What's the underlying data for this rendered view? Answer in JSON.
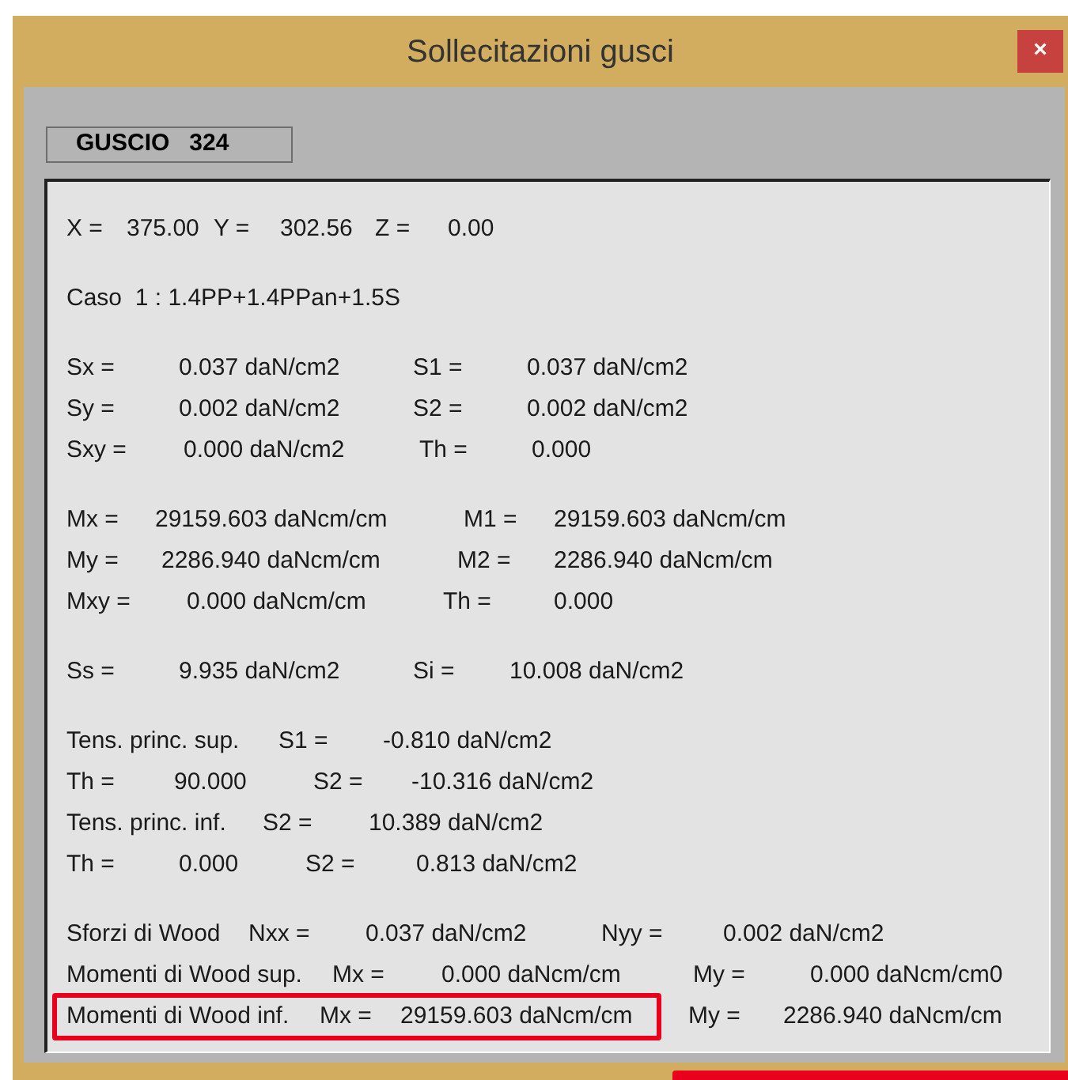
{
  "window": {
    "title": "Sollecitazioni gusci",
    "close": "×"
  },
  "shell_label": "GUSCIO   324",
  "blocks": [
    {
      "lines": [
        {
          "cells": [
            {
              "text": "X =",
              "highlighted": false
            },
            {
              "text": "375.00",
              "highlighted": false
            },
            {
              "text": "Y =",
              "highlighted": false
            },
            {
              "text": "302.56",
              "highlighted": false
            },
            {
              "text": "Z =",
              "highlighted": false
            },
            {
              "text": "0.00",
              "highlighted": false
            }
          ]
        }
      ]
    },
    {
      "lines": [
        {
          "cells": [
            {
              "text": "Caso  1 : 1.4PP+1.4PPan+1.5S",
              "highlighted": false
            }
          ]
        }
      ]
    },
    {
      "lines": [
        {
          "cells": [
            {
              "text": "Sx =",
              "highlighted": false
            },
            {
              "text": "0.037 daN/cm2",
              "highlighted": false
            },
            {
              "text": "S1 =",
              "highlighted": false
            },
            {
              "text": "0.037 daN/cm2",
              "highlighted": false
            }
          ]
        },
        {
          "cells": [
            {
              "text": "Sy =",
              "highlighted": false
            },
            {
              "text": "0.002 daN/cm2",
              "highlighted": false
            },
            {
              "text": "S2 =",
              "highlighted": false
            },
            {
              "text": "0.002 daN/cm2",
              "highlighted": false
            }
          ]
        },
        {
          "cells": [
            {
              "text": "Sxy =",
              "highlighted": false
            },
            {
              "text": "0.000 daN/cm2",
              "highlighted": false
            },
            {
              "text": "Th =",
              "highlighted": false
            },
            {
              "text": "0.000",
              "highlighted": false
            }
          ]
        }
      ]
    },
    {
      "lines": [
        {
          "cells": [
            {
              "text": "Mx =",
              "highlighted": false
            },
            {
              "text": "29159.603 daNcm/cm",
              "highlighted": false
            },
            {
              "text": "M1 =",
              "highlighted": false
            },
            {
              "text": "29159.603 daNcm/cm",
              "highlighted": false
            }
          ]
        },
        {
          "cells": [
            {
              "text": "My =",
              "highlighted": false
            },
            {
              "text": "2286.940 daNcm/cm",
              "highlighted": false
            },
            {
              "text": "M2 =",
              "highlighted": false
            },
            {
              "text": "2286.940 daNcm/cm",
              "highlighted": false
            }
          ]
        },
        {
          "cells": [
            {
              "text": "Mxy =",
              "highlighted": false
            },
            {
              "text": "0.000 daNcm/cm",
              "highlighted": false
            },
            {
              "text": "Th =",
              "highlighted": false
            },
            {
              "text": "0.000",
              "highlighted": false
            }
          ]
        }
      ]
    },
    {
      "lines": [
        {
          "cells": [
            {
              "text": "Ss =",
              "highlighted": false
            },
            {
              "text": "9.935 daN/cm2",
              "highlighted": false
            },
            {
              "text": "Si =",
              "highlighted": false
            },
            {
              "text": "10.008 daN/cm2",
              "highlighted": false
            }
          ]
        }
      ]
    },
    {
      "lines": [
        {
          "cells": [
            {
              "text": "Tens. princ. sup.",
              "highlighted": false
            },
            {
              "text": "S1 =",
              "highlighted": false
            },
            {
              "text": "-0.810 daN/cm2",
              "highlighted": false
            }
          ]
        },
        {
          "cells": [
            {
              "text": "Th =",
              "highlighted": false
            },
            {
              "text": "90.000",
              "highlighted": false
            },
            {
              "text": "S2 =",
              "highlighted": false
            },
            {
              "text": "-10.316 daN/cm2",
              "highlighted": false
            }
          ]
        },
        {
          "cells": [
            {
              "text": "Tens. princ. inf.",
              "highlighted": false
            },
            {
              "text": "S2 =",
              "highlighted": false
            },
            {
              "text": "10.389 daN/cm2",
              "highlighted": false
            }
          ]
        },
        {
          "cells": [
            {
              "text": "Th =",
              "highlighted": false
            },
            {
              "text": "0.000",
              "highlighted": false
            },
            {
              "text": "S2 =",
              "highlighted": false
            },
            {
              "text": "0.813 daN/cm2",
              "highlighted": false
            }
          ]
        }
      ]
    },
    {
      "lines": [
        {
          "cells": [
            {
              "text": "Sforzi di Wood",
              "highlighted": false
            },
            {
              "text": "Nxx =",
              "highlighted": false
            },
            {
              "text": "0.037 daN/cm2",
              "highlighted": false
            },
            {
              "text": "Nyy =",
              "highlighted": false
            },
            {
              "text": "0.002 daN/cm2",
              "highlighted": false
            }
          ]
        },
        {
          "cells": [
            {
              "text": "Momenti di Wood sup.",
              "highlighted": false
            },
            {
              "text": "Mx =",
              "highlighted": false
            },
            {
              "text": "0.000 daNcm/cm",
              "highlighted": false
            },
            {
              "text": "My =",
              "highlighted": false
            },
            {
              "text": "0.000 daNcm/cm0",
              "highlighted": false
            }
          ]
        },
        {
          "cells": [
            {
              "text": "Momenti di Wood inf.",
              "highlighted": true
            },
            {
              "text": "Mx =",
              "highlighted": true
            },
            {
              "text": "29159.603 daNcm/cm",
              "highlighted": true
            },
            {
              "text": "My =",
              "highlighted": false
            },
            {
              "text": "2286.940 daNcm/cm",
              "highlighted": false
            }
          ]
        }
      ]
    }
  ]
}
